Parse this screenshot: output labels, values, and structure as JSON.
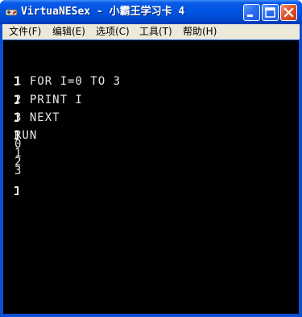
{
  "window": {
    "title": "VirtuaNESex - 小霸王学习卡 4",
    "icon": "nes-controller-icon"
  },
  "menu": [
    {
      "label": "文件(F)"
    },
    {
      "label": "编辑(E)"
    },
    {
      "label": "选项(C)"
    },
    {
      "label": "工具(T)"
    },
    {
      "label": "帮助(H)"
    }
  ],
  "screen": {
    "program_lines": [
      "1 FOR I=0 TO 3",
      "2 PRINT I",
      "3 NEXT",
      "RUN"
    ],
    "output_lines": [
      "0",
      "1",
      "2",
      "3"
    ]
  },
  "colors": {
    "titlebar": "#0054e3",
    "screen_bg": "#000000",
    "screen_text": "#e8e8e8"
  }
}
